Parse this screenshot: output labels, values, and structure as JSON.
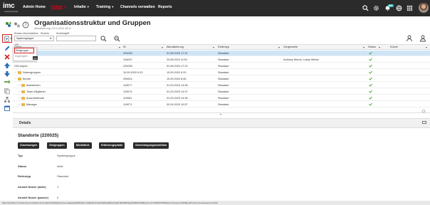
{
  "nav": {
    "logo_text": "imc",
    "logo_sub": "Learning Suite",
    "items": [
      {
        "label": "Admin Home",
        "active": false,
        "has_caret": false
      },
      {
        "label": "Nutzer",
        "active": true,
        "has_caret": true
      },
      {
        "label": "Inhalte",
        "active": false,
        "has_caret": true
      },
      {
        "label": "Training",
        "active": false,
        "has_caret": true
      },
      {
        "label": "Channels verwalten",
        "active": false,
        "has_caret": false
      },
      {
        "label": "Reports",
        "active": false,
        "has_caret": false
      }
    ],
    "notification_count": "99+",
    "accent_color": "#e1001a",
    "bar_color": "#2b2b2b"
  },
  "header": {
    "title": "Organisationsstruktur und Gruppen",
    "updated": "Aktualisierung: 15.11.2024 16:11"
  },
  "filters": {
    "type_label": "Knoten einschränken",
    "type_value": "Systemgruppe",
    "search_label": "Suchen",
    "term_label": "Suchbegriff",
    "term_value": ""
  },
  "dropdown": {
    "selected": "Zielgruppe",
    "item_ok": "OK",
    "item_second": "Angelegten",
    "tooltip": "aus"
  },
  "grid": {
    "headers": [
      "Name",
      "ID",
      "Aktualisierung",
      "Rollentyp",
      "Vorgesetzte",
      "Status",
      "Kürzel"
    ],
    "rows": [
      {
        "name": "",
        "id": "220025",
        "updated": "31.08.2020 17:31",
        "role": "Standard",
        "manager": "",
        "selected": true,
        "indent": 0,
        "folder": false
      },
      {
        "name": "Ok",
        "id": "316007",
        "updated": "29.08.2024 11:51",
        "role": "Standard",
        "manager": "Anthony Morris; Lukas Weber",
        "selected": false,
        "indent": 0,
        "folder": false
      },
      {
        "name": "OSI-Import",
        "id": "220026",
        "updated": "31.08.2020 17:22",
        "role": "Standard",
        "manager": "",
        "selected": false,
        "indent": 0,
        "folder": false
      },
      {
        "name": "Nutzergruppen",
        "id": "10.09.2020 9:20",
        "updated": "10.09.2020 9:20",
        "role": "Standard",
        "manager": "",
        "selected": false,
        "indent": 1,
        "folder": true
      },
      {
        "name": "Berufe",
        "id": "200614",
        "updated": "10.09.2020 8:46",
        "role": "Standard",
        "manager": "",
        "selected": false,
        "indent": 1,
        "folder": true
      },
      {
        "name": "Assistenten",
        "id": "119077",
        "updated": "31.03.2023 14:36",
        "role": "Standard",
        "manager": "",
        "selected": false,
        "indent": 2,
        "folder": true
      },
      {
        "name": "Team-Mitglieder",
        "id": "119074",
        "updated": "31.03.2023 14:37",
        "role": "Standard",
        "manager": "",
        "selected": false,
        "indent": 2,
        "folder": true
      },
      {
        "name": "Auszubildende",
        "id": "119081",
        "updated": "31.03.2023 14:36",
        "role": "Standard",
        "manager": "",
        "selected": false,
        "indent": 2,
        "folder": true
      },
      {
        "name": "Manager",
        "id": "119071",
        "updated": "03.04.2020 10:57",
        "role": "Standard",
        "manager": "",
        "selected": false,
        "indent": 2,
        "folder": true
      }
    ]
  },
  "details": {
    "section_title": "Details",
    "heading": "Standorte (220025)",
    "buttons": [
      "Zuweisungen",
      "Zielgruppen",
      "Mediathek",
      "Erfahrungspfade",
      "Genehmigungsworkflow"
    ],
    "fields": [
      {
        "label": "Typ",
        "value": "Systemgruppe"
      },
      {
        "label": "Status",
        "value": "Aktiv"
      },
      {
        "label": "Rollentyp",
        "value": "Standard"
      },
      {
        "label": "Anzahl Nutzer (aktiv)",
        "value": "1"
      },
      {
        "label": "Anzahl Nutzer (passiv)",
        "value": "0"
      }
    ]
  },
  "statusbar": {
    "url": "https://prodbox.imc-learning.com/ils/cls.do?nodeId=22448|orActive=navigate&SIRP&dem=0|FMAnnSAHCWIHkd&tFkwCjkiTdtD39FP9aySMMNkLTB&bytes=1713108072525&prio=&rowsx=22448|ossProctis=internameprocessSF"
  },
  "colors": {
    "selected_row": "#cfe5f7",
    "status_ok": "#3a9d23",
    "badge": "#2eb8b8"
  }
}
